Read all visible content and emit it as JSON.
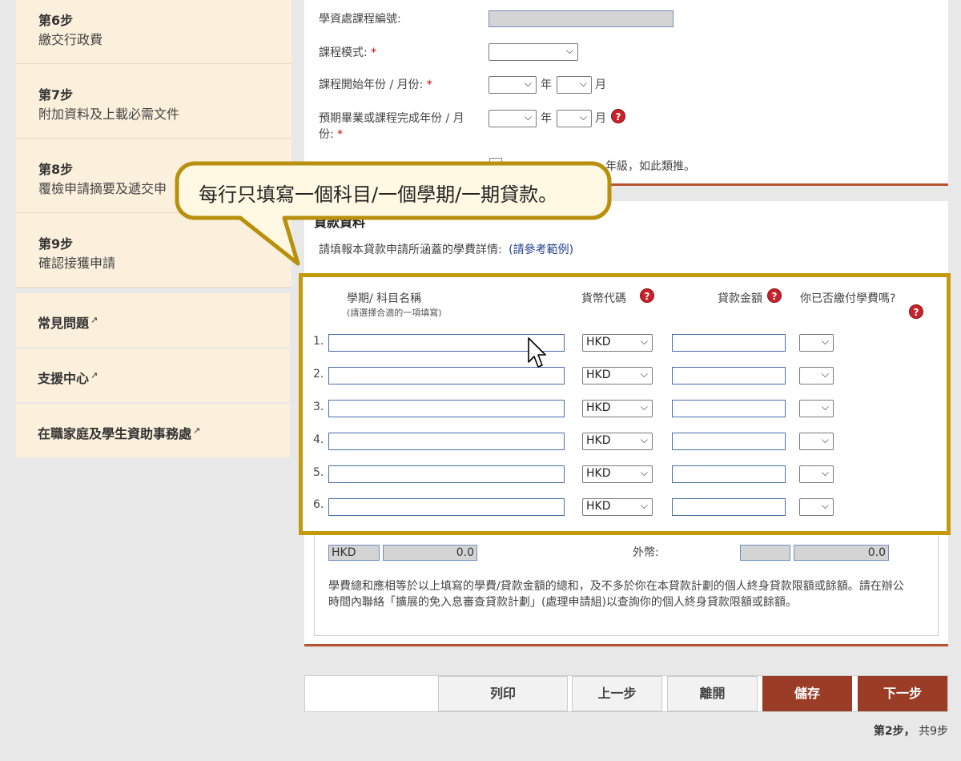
{
  "sidebar": {
    "steps": [
      {
        "num": "第6步",
        "label": "繳交行政費"
      },
      {
        "num": "第7步",
        "label": "附加資料及上載必需文件"
      },
      {
        "num": "第8步",
        "label": "覆檢申請摘要及遞交申"
      },
      {
        "num": "第9步",
        "label": "確認接獲申請"
      }
    ],
    "links": [
      {
        "label": "常見問題"
      },
      {
        "label": "支援中心"
      },
      {
        "label": "在職家庭及學生資助事務處"
      }
    ],
    "external_icon": "↗"
  },
  "course": {
    "course_no_label": "學資處課程編號:",
    "mode_label": "課程模式:",
    "start_label": "課程開始年份 / 月份:",
    "grad_label_line1": "預期畢業或課程完成年份 / 月",
    "grad_label_line2": "份:",
    "required_mark": "*",
    "year_unit": "年",
    "month_unit": "月",
    "partial_text": "年級，如此類推。"
  },
  "tooltip": {
    "text": "每行只填寫一個科目/一個學期/一期貸款。"
  },
  "loan": {
    "section_title_partial": "貸款資料",
    "intro": "請填報本貸款申請所涵蓋的學費詳情:",
    "example_link": "(請參考範例)",
    "headers": {
      "term": "學期/ 科目名稱",
      "term_hint": "(請選擇合適的一項填寫)",
      "currency": "貨幣代碼",
      "amount": "貸款金額",
      "paid": "你已否繳付學費嗎?"
    },
    "rows": [
      {
        "num": "1.",
        "currency": "HKD"
      },
      {
        "num": "2.",
        "currency": "HKD"
      },
      {
        "num": "3.",
        "currency": "HKD"
      },
      {
        "num": "4.",
        "currency": "HKD"
      },
      {
        "num": "5.",
        "currency": "HKD"
      },
      {
        "num": "6.",
        "currency": "HKD"
      }
    ],
    "totals": {
      "hkd_code": "HKD",
      "hkd_total": "0.0",
      "foreign_label": "外幣:",
      "foreign_total": "0.0"
    },
    "note": "學費總和應相等於以上填寫的學費/貸款金額的總和，及不多於你在本貸款計劃的個人終身貸款限額或餘額。請在辦公時間內聯絡「擴展的免入息審查貸款計劃」(處理申請組)以查詢你的個人終身貸款限額或餘額。"
  },
  "buttons": {
    "print": "列印",
    "prev": "上一步",
    "leave": "離開",
    "save": "儲存",
    "next": "下一步"
  },
  "progress": {
    "current": "第2步，",
    "total": "共9步"
  },
  "help_icon_glyph": "?",
  "colors": {
    "accent": "#9a3c26",
    "highlight": "#c49a0c",
    "sidebar_bg": "#fbf0dc"
  }
}
